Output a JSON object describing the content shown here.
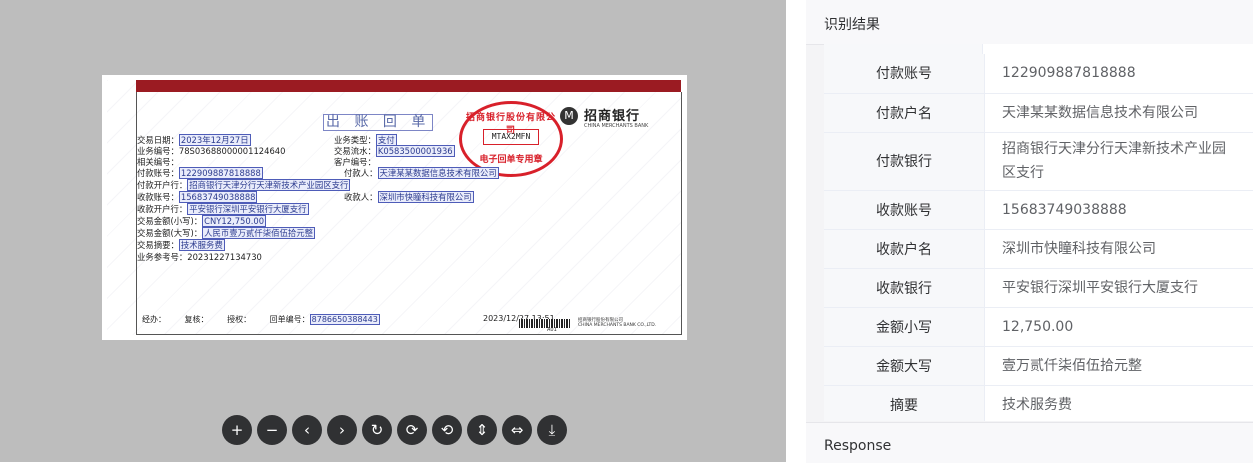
{
  "receipt": {
    "title": "出 账 回 单",
    "seal_top": "招商银行股份有限公司",
    "seal_code": "MTAX2MFN",
    "seal_bottom": "电子回单专用章",
    "bank_cn": "招商银行",
    "bank_en": "CHINA MERCHANTS BANK",
    "trade_date": {
      "label": "交易日期：",
      "value": "2023年12月27日"
    },
    "business_type": {
      "label": "业务类型：",
      "value": "支付"
    },
    "business_no": {
      "label": "业务编号：",
      "value": "78S036880000011246​40"
    },
    "serial_no": {
      "label": "交易流水：",
      "value": "K0583500001936"
    },
    "related_no": {
      "label": "相关编号：",
      "value": ""
    },
    "customer_no": {
      "label": "客户编号：",
      "value": ""
    },
    "payer_account": {
      "label": "付款账号：",
      "value": "122909887818888"
    },
    "payer": {
      "label": "付款人：",
      "value": "天津某某数据信息技术有限公司"
    },
    "payer_bank": {
      "label": "付款开户行：",
      "value": "招商银行天津分行天津新技术产业园区支行"
    },
    "payee_account": {
      "label": "收款账号：",
      "value": "15683749038888"
    },
    "payee": {
      "label": "收款人：",
      "value": "深圳市快瞳科技有限公司"
    },
    "payee_bank": {
      "label": "收款开户行：",
      "value": "平安银行深圳平安银行大厦支行"
    },
    "amount_small": {
      "label": "交易金额(小写)：",
      "value": "CNY12,750.00"
    },
    "amount_big": {
      "label": "交易金额(大写)：",
      "value": "人民币壹万贰仟柒佰伍拾元整"
    },
    "summary": {
      "label": "交易摘要：",
      "value": "技术服务费"
    },
    "reference": {
      "label": "业务参考号：",
      "value": "20231227134730"
    },
    "sign_handler": "经办：",
    "sign_review": "复核：",
    "sign_auth": "授权：",
    "receipt_no_label": "回单编号：",
    "receipt_no": "8786650388443",
    "footer_date": "2023/12/27 13:51",
    "footer_small": "招商银行股份有限公司",
    "footer_small_en": "CHINA MERCHANTS BANK CO.,LTD.",
    "footer_code": "A01"
  },
  "toolbar": [
    {
      "name": "zoom-in-button",
      "icon": "+"
    },
    {
      "name": "zoom-out-button",
      "icon": "−"
    },
    {
      "name": "prev-button",
      "icon": "‹"
    },
    {
      "name": "next-button",
      "icon": "›"
    },
    {
      "name": "rotate-reset-button",
      "icon": "↻"
    },
    {
      "name": "rotate-right-button",
      "icon": "⟳"
    },
    {
      "name": "rotate-left-button",
      "icon": "⟲"
    },
    {
      "name": "fit-height-button",
      "icon": "⇕"
    },
    {
      "name": "fit-width-button",
      "icon": "⇔"
    },
    {
      "name": "download-button",
      "icon": "⤓"
    }
  ],
  "panel": {
    "header": "识别结果",
    "footer": "Response",
    "rows": [
      {
        "key": "付款账号",
        "value": "122909887818888"
      },
      {
        "key": "付款户名",
        "value": "天津某某数据信息技术有限公司"
      },
      {
        "key": "付款银行",
        "value": "招商银行天津分行天津新技术产业园区支行"
      },
      {
        "key": "收款账号",
        "value": "15683749038888"
      },
      {
        "key": "收款户名",
        "value": "深圳市快瞳科技有限公司"
      },
      {
        "key": "收款银行",
        "value": "平安银行深圳平安银行大厦支行"
      },
      {
        "key": "金额小写",
        "value": "12,750.00"
      },
      {
        "key": "金额大写",
        "value": "壹万贰仟柒佰伍拾元整"
      },
      {
        "key": "摘要",
        "value": "技术服务费"
      }
    ]
  }
}
